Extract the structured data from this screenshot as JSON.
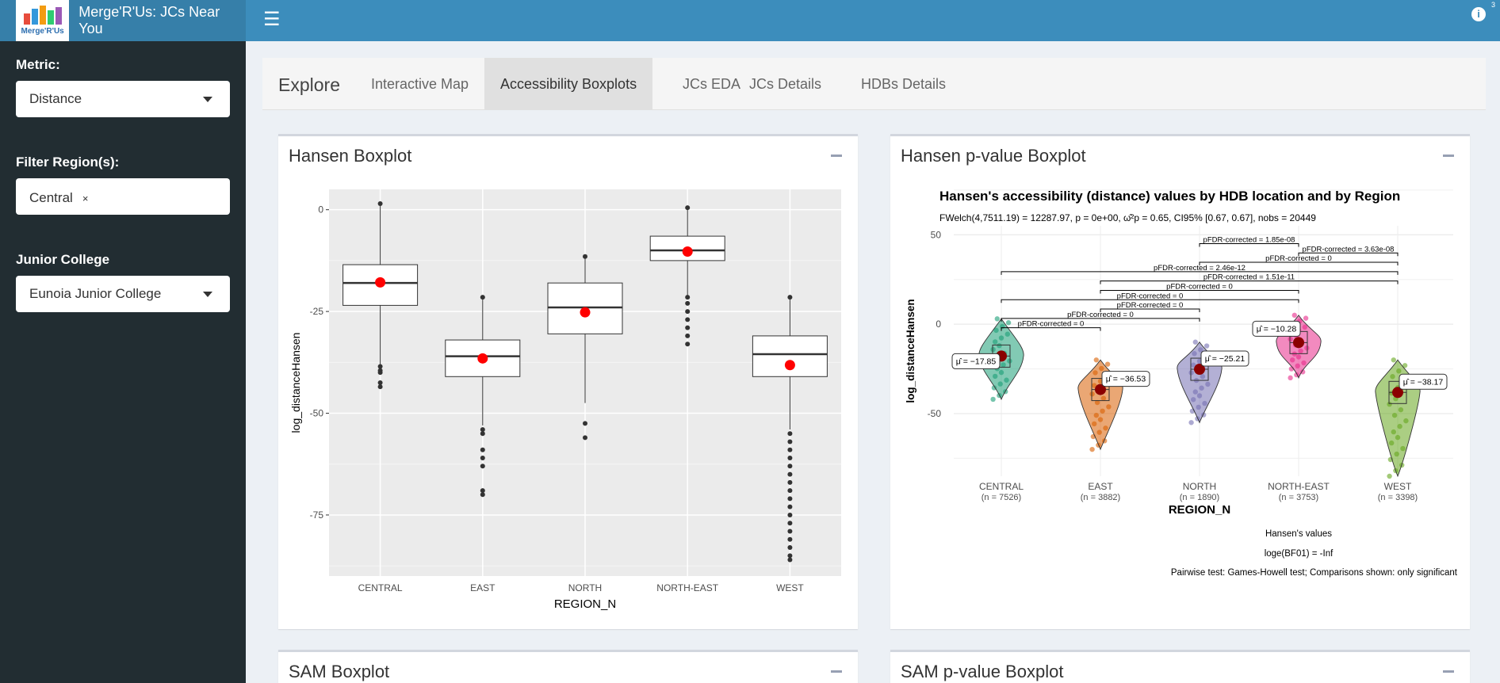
{
  "app": {
    "title": "Merge'R'Us: JCs Near You",
    "logo_text": "Merge'R'Us",
    "info_badge": "3"
  },
  "sidebar": {
    "metric_label": "Metric:",
    "metric_value": "Distance",
    "region_label": "Filter Region(s):",
    "region_tag": "Central",
    "region_tag_remove": "×",
    "jc_label": "Junior College",
    "jc_value": "Eunoia Junior College"
  },
  "tabs": {
    "title": "Explore",
    "items": [
      "Interactive Map",
      "Accessibility Boxplots",
      "JCs EDA",
      "JCs Details",
      "HDBs Details"
    ],
    "active_index": 1
  },
  "boxes": {
    "hansen": "Hansen Boxplot",
    "hansen_p": "Hansen p-value Boxplot",
    "sam": "SAM Boxplot",
    "sam_p": "SAM p-value Boxplot"
  },
  "colors": {
    "header": "#3c8dbc",
    "sidebar": "#222d32",
    "mean_point": "#ff0000",
    "central": "#1b9e77",
    "east": "#d95f02",
    "north": "#7570b3",
    "northeast": "#e7298a",
    "west": "#66a61e"
  },
  "chart_data": [
    {
      "type": "boxplot",
      "xlabel": "REGION_N",
      "ylabel": "log_distanceHansen",
      "ylim": [
        -90,
        5
      ],
      "yticks": [
        "0",
        "-25",
        "-50",
        "-75"
      ],
      "categories": [
        "CENTRAL",
        "EAST",
        "NORTH",
        "NORTH-EAST",
        "WEST"
      ],
      "series": [
        {
          "q1": -23.5,
          "median": -18,
          "q3": -13.5,
          "min": -39,
          "max": 1.5,
          "mean": -17.85,
          "outliers": [
            -38.5,
            -39.5,
            -40,
            -42.5,
            -43.5
          ]
        },
        {
          "q1": -41,
          "median": -36,
          "q3": -32,
          "min": -53,
          "max": -21.5,
          "mean": -36.53,
          "outliers": [
            -54,
            -55,
            -59,
            -61,
            -63,
            -69,
            -70
          ]
        },
        {
          "q1": -30.5,
          "median": -24,
          "q3": -18,
          "min": -47.5,
          "max": -11.5,
          "mean": -25.21,
          "outliers": [
            -52.5,
            -56
          ]
        },
        {
          "q1": -12.5,
          "median": -10,
          "q3": -6.5,
          "min": -21,
          "max": 0.5,
          "mean": -10.28,
          "outliers": [
            -21.5,
            -23,
            -25,
            -27,
            -29,
            -31,
            -33
          ]
        },
        {
          "q1": -41,
          "median": -35.5,
          "q3": -31,
          "min": -54,
          "max": -21.5,
          "mean": -38.17,
          "outliers": [
            -55,
            -57,
            -59,
            -61,
            -63,
            -65,
            -67,
            -69,
            -71,
            -73,
            -75,
            -77,
            -79,
            -81,
            -83,
            -85,
            -86
          ]
        }
      ],
      "legend": "none",
      "grid": true
    },
    {
      "type": "violin",
      "title": "Hansen's accessibility (distance) values by HDB location and by Region",
      "subtitle": "FWelch(4,7511.19) = 12287.97, p = 0e+00, ω̂²p = 0.65, CI95% [0.67, 0.67], nobs = 20449",
      "xlabel": "REGION_N",
      "ylabel": "log_distanceHansen",
      "ylim": [
        -85,
        55
      ],
      "yticks": [
        "50",
        "0",
        "-50"
      ],
      "categories": [
        "CENTRAL",
        "EAST",
        "NORTH",
        "NORTH-EAST",
        "WEST"
      ],
      "n_labels": [
        "(n = 7526)",
        "(n = 3882)",
        "(n = 1890)",
        "(n = 3753)",
        "(n = 3398)"
      ],
      "means": [
        -17.85,
        -36.53,
        -25.21,
        -10.28,
        -38.17
      ],
      "mean_labels": [
        "μ̂ = −17.85",
        "μ̂ = −36.53",
        "μ̂ = −25.21",
        "μ̂ = −10.28",
        "μ̂ = −38.17"
      ],
      "pairwise": [
        {
          "from": 0,
          "to": 1,
          "label": "pFDR-corrected = 0"
        },
        {
          "from": 0,
          "to": 2,
          "label": "pFDR-corrected = 0"
        },
        {
          "from": 1,
          "to": 2,
          "label": "pFDR-corrected = 0"
        },
        {
          "from": 0,
          "to": 3,
          "label": "pFDR-corrected = 0"
        },
        {
          "from": 1,
          "to": 3,
          "label": "pFDR-corrected = 0"
        },
        {
          "from": 1,
          "to": 4,
          "label": "pFDR-corrected = 1.51e-11"
        },
        {
          "from": 0,
          "to": 4,
          "label": "pFDR-corrected = 2.46e-12"
        },
        {
          "from": 2,
          "to": 4,
          "label": "pFDR-corrected = 0"
        },
        {
          "from": 3,
          "to": 4,
          "label": "pFDR-corrected = 3.63e-08"
        },
        {
          "from": 2,
          "to": 3,
          "label": "pFDR-corrected = 1.85e-08"
        }
      ],
      "caption_bf": "Hansen's values",
      "caption_log": "loge(BF01) = -Inf",
      "caption_pairwise": "Pairwise test: Games-Howell test; Comparisons shown: only significant"
    }
  ]
}
